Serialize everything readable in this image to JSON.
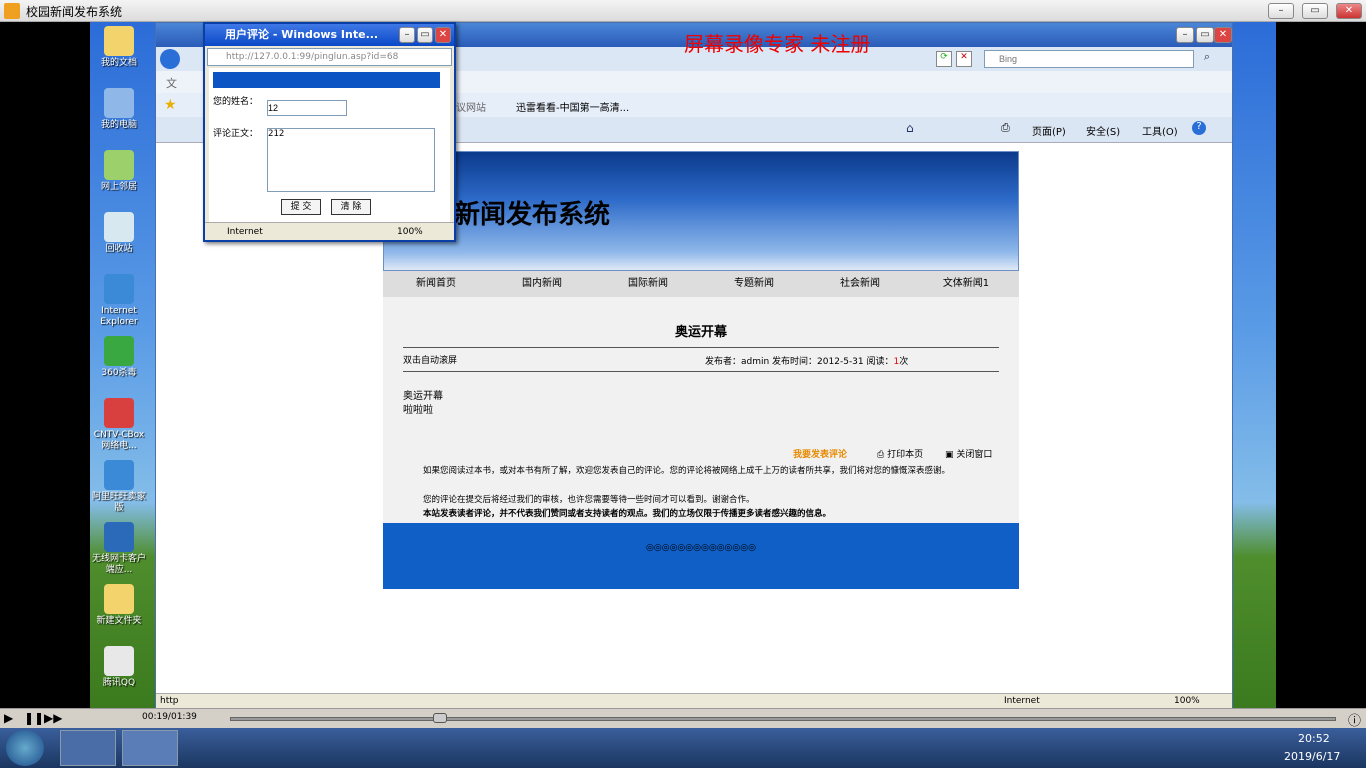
{
  "player": {
    "title": "校园新闻发布系统",
    "time": "00:19/01:39",
    "progress": 0.19
  },
  "watermark": "屏幕录像专家  未注册",
  "desktop_icons": [
    {
      "label": "我的文档",
      "icon": "documents-icon"
    },
    {
      "label": "我的电脑",
      "icon": "computer-icon"
    },
    {
      "label": "网上邻居",
      "icon": "network-icon"
    },
    {
      "label": "回收站",
      "icon": "recycle-bin-icon"
    },
    {
      "label": "Internet Explorer",
      "icon": "ie-icon"
    },
    {
      "label": "360杀毒",
      "icon": "antivirus-icon"
    },
    {
      "label": "CNTV-CBox 网络电...",
      "icon": "tv-icon"
    },
    {
      "label": "阿里旺旺卖家版",
      "icon": "chat-icon"
    },
    {
      "label": "无线网卡客户端应...",
      "icon": "wireless-icon"
    },
    {
      "label": "新建文件夹",
      "icon": "folder-icon"
    },
    {
      "label": "腾讯QQ",
      "icon": "qq-icon"
    }
  ],
  "ie": {
    "search_placeholder": "Bing",
    "fav_item": "迅雷看看-中国第一高清...",
    "fav_item2": "议网站",
    "menu_hint": "文",
    "tools": [
      "页面(P)",
      "安全(S)",
      "工具(O)"
    ],
    "status_text": "http",
    "zone": "Internet",
    "zoom": "100%"
  },
  "site": {
    "banner_title": "新闻发布系统",
    "nav": [
      "新闻首页",
      "国内新闻",
      "国际新闻",
      "专题新闻",
      "社会新闻",
      "文体新闻1"
    ],
    "article_title": "奥运开幕",
    "scroll_hint": "双击自动滚屏",
    "meta_prefix": "发布者：admin 发布时间：2012-5-31 阅读：",
    "meta_count": "1",
    "meta_suffix": "次",
    "body_line1": "奥运开幕",
    "body_line2": "啦啦啦",
    "comment_link": "我要发表评论",
    "print_link": "打印本页",
    "close_link": "关闭窗口",
    "notice1": "如果您阅读过本书，或对本书有所了解，欢迎您发表自己的评论。您的评论将被网络上成千上万的读者所共享，我们将对您的慷慨深表感谢。",
    "notice2": "您的评论在提交后将经过我们的审核，也许您需要等待一些时间才可以看到。谢谢合作。",
    "notice3": "本站发表读者评论，并不代表我们赞同或者支持读者的观点。我们的立场仅限于传播更多读者感兴趣的信息。",
    "footer": "◎◎◎◎◎◎◎◎◎◎◎◎◎◎"
  },
  "popup": {
    "title": "用户评论 - Windows Inte...",
    "url": "http://127.0.0.1:99/pinglun.asp?id=68",
    "name_label": "您的姓名：",
    "name_value": "12",
    "body_label": "评论正文：",
    "body_value": "212",
    "submit": "提 交",
    "clear": "清 除",
    "zone": "Internet",
    "zoom": "100%"
  },
  "taskbar": {
    "time": "20:52",
    "date": "2019/6/17"
  }
}
